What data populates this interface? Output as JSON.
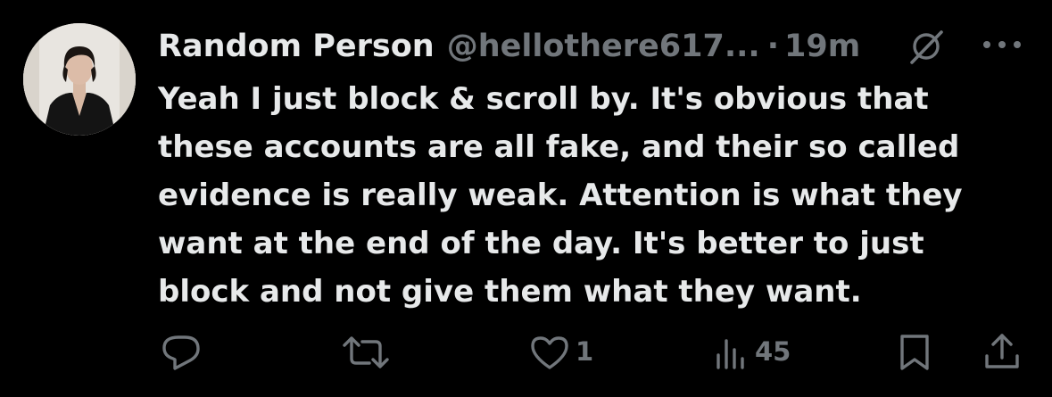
{
  "tweet": {
    "author_name": "Random Person",
    "handle": "@hellothere617...",
    "separator": "·",
    "time": "19m",
    "lines": [
      "Yeah I just block & scroll by. It's obvious that",
      "these accounts are all fake, and their so called",
      "evidence is really weak. Attention is what they",
      "want at the end of the day. It's better to just",
      "block and not give them what they want."
    ]
  },
  "actions": {
    "likes": "1",
    "views": "45"
  },
  "colors": {
    "background": "#000000",
    "text_primary": "#e7e9ea",
    "text_secondary": "#71767b"
  },
  "icons": [
    "grok-icon",
    "more-icon",
    "reply-icon",
    "retweet-icon",
    "like-icon",
    "views-icon",
    "bookmark-icon",
    "share-icon"
  ]
}
